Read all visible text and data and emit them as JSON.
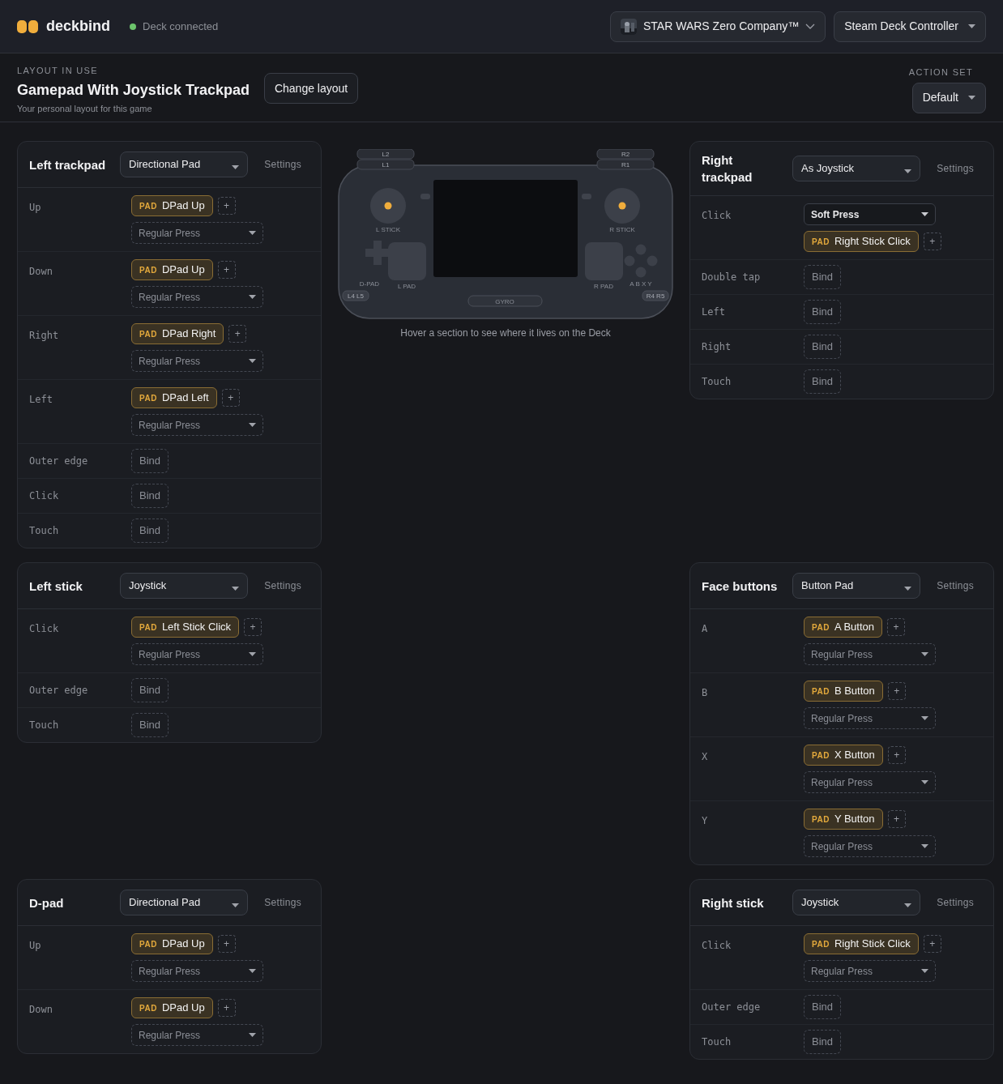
{
  "app": {
    "name": "deckbind",
    "status": "Deck connected",
    "connected": true
  },
  "game_select": {
    "label": "STAR WARS Zero Company™"
  },
  "controller_select": {
    "label": "Steam Deck Controller"
  },
  "layout": {
    "caption": "LAYOUT IN USE",
    "name": "Gamepad With Joystick Trackpad",
    "note": "Your personal layout for this game",
    "button": "Change layout"
  },
  "action_set": {
    "caption": "ACTION SET",
    "value": "Default"
  },
  "deck": {
    "l2": "L2",
    "l1": "L1",
    "r2": "R2",
    "r1": "R1",
    "l_stick": "L STICK",
    "r_stick": "R STICK",
    "d_pad": "D-PAD",
    "l_pad": "L PAD",
    "r_pad": "R PAD",
    "abxy": "A B X Y",
    "l4l5": "L4 L5",
    "r4r5": "R4 R5",
    "gyro": "GYRO",
    "hint": "Hover a section to see where it lives on the Deck"
  },
  "left_column": [
    {
      "title": "Left trackpad",
      "mode": "Directional Pad",
      "settings": "Settings",
      "rows": [
        {
          "label": "Up",
          "kind": "binding",
          "tag": "PAD",
          "action": "DPad Up",
          "add": "+",
          "mode": {
            "label": "Regular Press",
            "custom": false
          }
        },
        {
          "label": "Down",
          "kind": "binding",
          "tag": "PAD",
          "action": "DPad Up",
          "add": "+",
          "mode": {
            "label": "Regular Press",
            "custom": false
          }
        },
        {
          "label": "Right",
          "kind": "binding",
          "tag": "PAD",
          "action": "DPad Right",
          "add": "+",
          "mode": {
            "label": "Regular Press",
            "custom": false
          }
        },
        {
          "label": "Left",
          "kind": "binding",
          "tag": "PAD",
          "action": "DPad Left",
          "add": "+",
          "mode": {
            "label": "Regular Press",
            "custom": false
          }
        },
        {
          "label": "Outer edge",
          "kind": "empty",
          "button": "Bind"
        },
        {
          "label": "Click",
          "kind": "empty",
          "button": "Bind"
        },
        {
          "label": "Touch",
          "kind": "empty",
          "button": "Bind"
        }
      ]
    },
    {
      "title": "Left stick",
      "mode": "Joystick",
      "settings": "Settings",
      "rows": [
        {
          "label": "Click",
          "kind": "binding",
          "tag": "PAD",
          "action": "Left Stick Click",
          "add": "+",
          "mode": {
            "label": "Regular Press",
            "custom": false
          }
        },
        {
          "label": "Outer edge",
          "kind": "empty",
          "button": "Bind"
        },
        {
          "label": "Touch",
          "kind": "empty",
          "button": "Bind"
        }
      ]
    },
    {
      "title": "D-pad",
      "mode": "Directional Pad",
      "settings": "Settings",
      "rows": [
        {
          "label": "Up",
          "kind": "binding",
          "tag": "PAD",
          "action": "DPad Up",
          "add": "+",
          "mode": {
            "label": "Regular Press",
            "custom": false
          }
        },
        {
          "label": "Down",
          "kind": "binding",
          "tag": "PAD",
          "action": "DPad Up",
          "add": "+",
          "mode": {
            "label": "Regular Press",
            "custom": false
          }
        }
      ]
    }
  ],
  "right_column": [
    {
      "title": "Right trackpad",
      "mode": "As Joystick",
      "settings": "Settings",
      "rows": [
        {
          "label": "Click",
          "kind": "mode_binding",
          "tag": "PAD",
          "action": "Right Stick Click",
          "add": "+",
          "mode": {
            "label": "Soft Press",
            "custom": true
          }
        },
        {
          "label": "Double tap",
          "kind": "empty",
          "button": "Bind"
        },
        {
          "label": "Left",
          "kind": "empty",
          "button": "Bind"
        },
        {
          "label": "Right",
          "kind": "empty",
          "button": "Bind"
        },
        {
          "label": "Touch",
          "kind": "empty",
          "button": "Bind"
        }
      ]
    },
    {
      "title": "Face buttons",
      "mode": "Button Pad",
      "settings": "Settings",
      "rows": [
        {
          "label": "A",
          "kind": "binding",
          "tag": "PAD",
          "action": "A Button",
          "add": "+",
          "mode": {
            "label": "Regular Press",
            "custom": false
          }
        },
        {
          "label": "B",
          "kind": "binding",
          "tag": "PAD",
          "action": "B Button",
          "add": "+",
          "mode": {
            "label": "Regular Press",
            "custom": false
          }
        },
        {
          "label": "X",
          "kind": "binding",
          "tag": "PAD",
          "action": "X Button",
          "add": "+",
          "mode": {
            "label": "Regular Press",
            "custom": false
          }
        },
        {
          "label": "Y",
          "kind": "binding",
          "tag": "PAD",
          "action": "Y Button",
          "add": "+",
          "mode": {
            "label": "Regular Press",
            "custom": false
          }
        }
      ]
    },
    {
      "title": "Right stick",
      "mode": "Joystick",
      "settings": "Settings",
      "rows": [
        {
          "label": "Click",
          "kind": "binding",
          "tag": "PAD",
          "action": "Right Stick Click",
          "add": "+",
          "mode": {
            "label": "Regular Press",
            "custom": false
          }
        },
        {
          "label": "Outer edge",
          "kind": "empty",
          "button": "Bind"
        },
        {
          "label": "Touch",
          "kind": "empty",
          "button": "Bind"
        }
      ]
    }
  ]
}
